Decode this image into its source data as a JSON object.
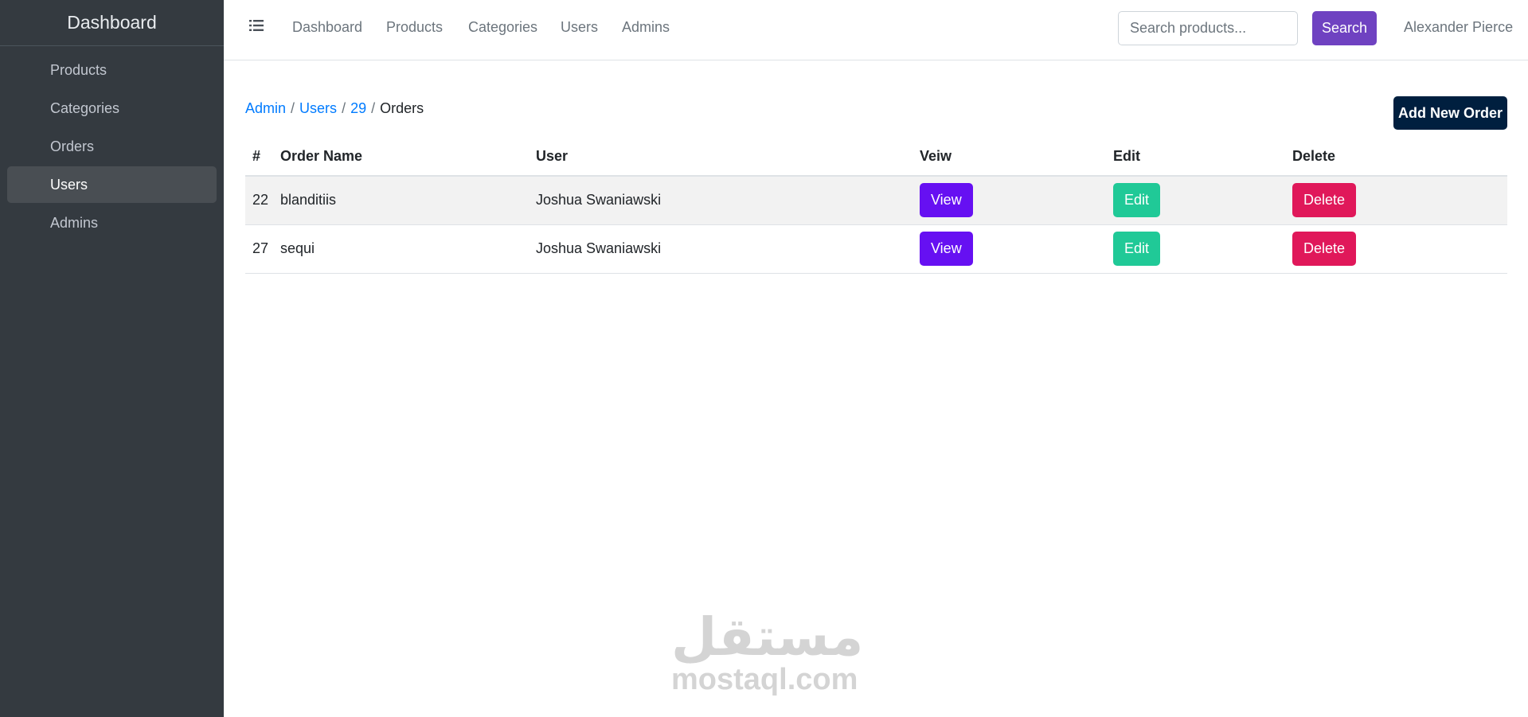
{
  "sidebar": {
    "brand": "Dashboard",
    "items": [
      {
        "label": "Products",
        "active": false
      },
      {
        "label": "Categories",
        "active": false
      },
      {
        "label": "Orders",
        "active": false
      },
      {
        "label": "Users",
        "active": true
      },
      {
        "label": "Admins",
        "active": false
      }
    ]
  },
  "topbar": {
    "menu_icon": "list-icon",
    "links": [
      "Dashboard",
      "Products",
      "Categories",
      "Users",
      "Admins"
    ],
    "search": {
      "placeholder": "Search products...",
      "value": "",
      "button_label": "Search"
    },
    "user_name": "Alexander Pierce"
  },
  "breadcrumb": {
    "items": [
      "Admin",
      "Users",
      "29"
    ],
    "current": "Orders"
  },
  "add_button_label": "Add New Order",
  "table": {
    "headers": [
      "#",
      "Order Name",
      "User",
      "Veiw",
      "Edit",
      "Delete"
    ],
    "rows": [
      {
        "id": "22",
        "order_name": "blanditiis",
        "user": "Joshua Swaniawski",
        "view": "View",
        "edit": "Edit",
        "delete": "Delete"
      },
      {
        "id": "27",
        "order_name": "sequi",
        "user": "Joshua Swaniawski",
        "view": "View",
        "edit": "Edit",
        "delete": "Delete"
      }
    ]
  },
  "watermark": {
    "arabic": "مستقل",
    "latin": "mostaql.com"
  },
  "colors": {
    "sidebar_bg": "#343a40",
    "search_button": "#6f42c1",
    "add_button": "#001f3f",
    "view_button": "#6610f2",
    "edit_button": "#20c997",
    "delete_button": "#e0185a",
    "link": "#007bff"
  }
}
